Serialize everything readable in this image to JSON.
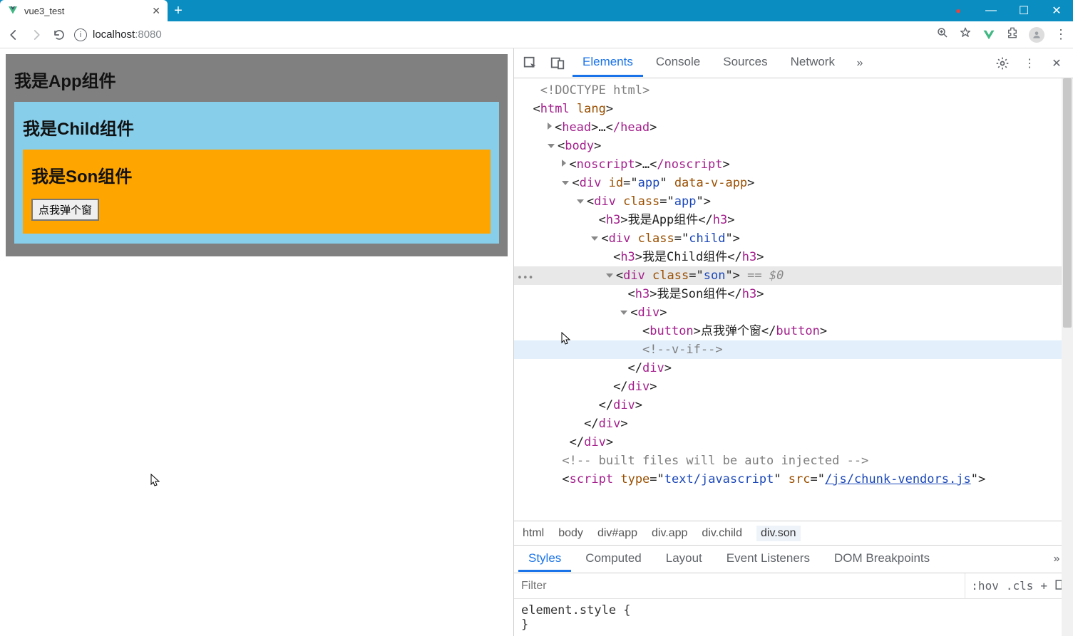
{
  "browser": {
    "tab_title": "vue3_test",
    "url_host": "localhost",
    "url_port": ":8080",
    "window_buttons": {
      "min": "—",
      "max": "☐",
      "close": "✕"
    },
    "newtab": "+"
  },
  "page": {
    "app_heading": "我是App组件",
    "child_heading": "我是Child组件",
    "son_heading": "我是Son组件",
    "button_label": "点我弹个窗"
  },
  "devtools": {
    "tabs": {
      "elements": "Elements",
      "console": "Console",
      "sources": "Sources",
      "network": "Network"
    },
    "dom": {
      "doctype": "<!DOCTYPE html>",
      "html_open": "html",
      "html_attr": "lang",
      "head_open": "head",
      "head_ell": "…",
      "head_close": "/head",
      "body": "body",
      "noscript_open": "noscript",
      "noscript_ell": "…",
      "noscript_close": "/noscript",
      "div_app_id": "app",
      "div_app_attr": "data-v-app",
      "class_app": "app",
      "h3_app_text": "我是App组件",
      "class_child": "child",
      "h3_child_text": "我是Child组件",
      "class_son": "son",
      "sel_annot": " == $0",
      "h3_son_text": "我是Son组件",
      "btn_text": "点我弹个窗",
      "vif": "<!--v-if-->",
      "comment_built": "<!-- built files will be auto injected -->",
      "script_type": "text/javascript",
      "script_src": "/js/chunk-vendors.js"
    },
    "breadcrumb": [
      "html",
      "body",
      "div#app",
      "div.app",
      "div.child",
      "div.son"
    ],
    "styles_tabs": {
      "styles": "Styles",
      "computed": "Computed",
      "layout": "Layout",
      "eventlisteners": "Event Listeners",
      "dom": "DOM Breakpoints"
    },
    "filter_placeholder": "Filter",
    "chips": {
      "hov": ":hov",
      "cls": ".cls",
      "plus": "+"
    },
    "styles_body": {
      "l1": "element.style {",
      "l2": "}"
    }
  }
}
